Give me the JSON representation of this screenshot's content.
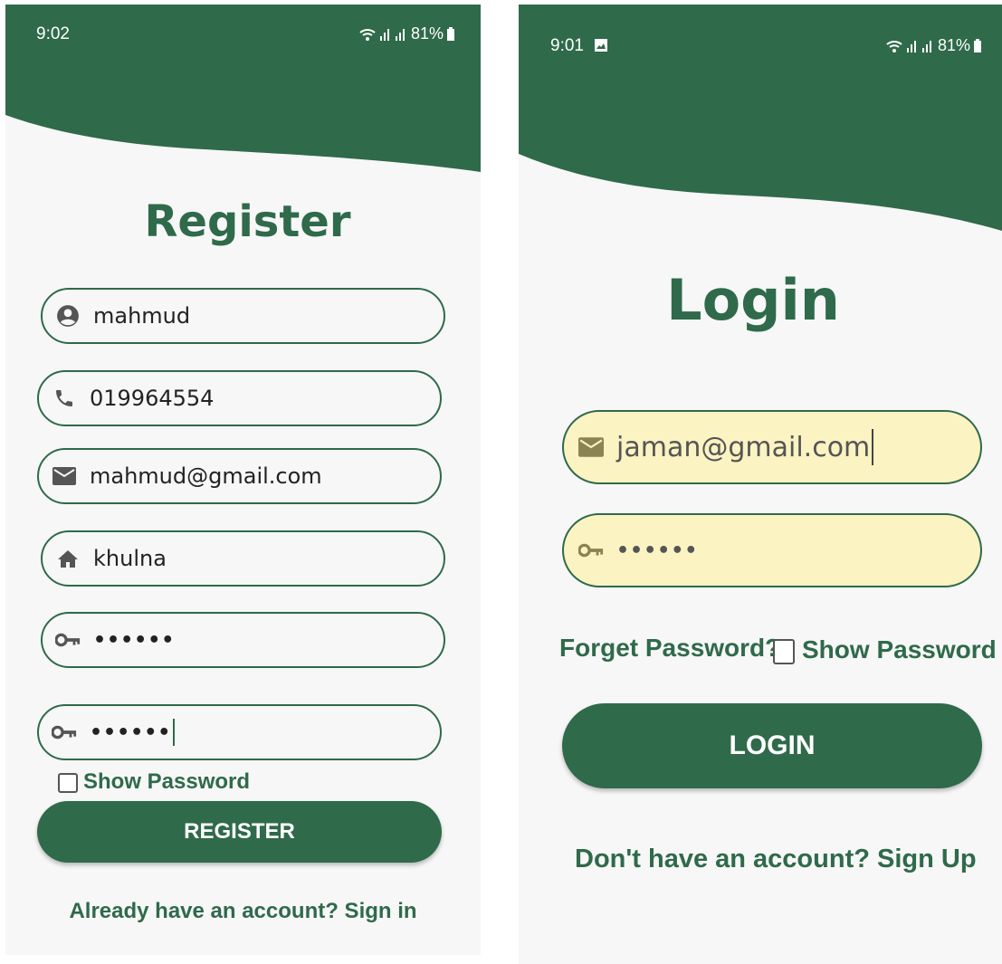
{
  "colors": {
    "primary": "#2f6a4a",
    "autofill": "#fcf3c2"
  },
  "register": {
    "status": {
      "time": "9:02",
      "battery": "81%"
    },
    "title": "Register",
    "fields": {
      "name": {
        "icon": "account-circle-icon",
        "value": "mahmud"
      },
      "phone": {
        "icon": "phone-icon",
        "value": "019964554"
      },
      "email": {
        "icon": "email-icon",
        "value": "mahmud@gmail.com"
      },
      "address": {
        "icon": "home-icon",
        "value": "khulna"
      },
      "password": {
        "icon": "key-icon",
        "value": "••••••"
      },
      "confirm_password": {
        "icon": "key-icon",
        "value": "••••••"
      }
    },
    "show_password_label": "Show Password",
    "register_button": "REGISTER",
    "sign_in_link": "Already have an account? Sign in"
  },
  "login": {
    "status": {
      "time": "9:01",
      "battery": "81%"
    },
    "title": "Login",
    "fields": {
      "email": {
        "icon": "email-icon",
        "value": "jaman@gmail.com"
      },
      "password": {
        "icon": "key-icon",
        "value": "••••••"
      }
    },
    "forget_password": "Forget Password?",
    "show_password_label": "Show Password",
    "login_button": "LOGIN",
    "sign_up_link": "Don't have an account?  Sign Up"
  }
}
